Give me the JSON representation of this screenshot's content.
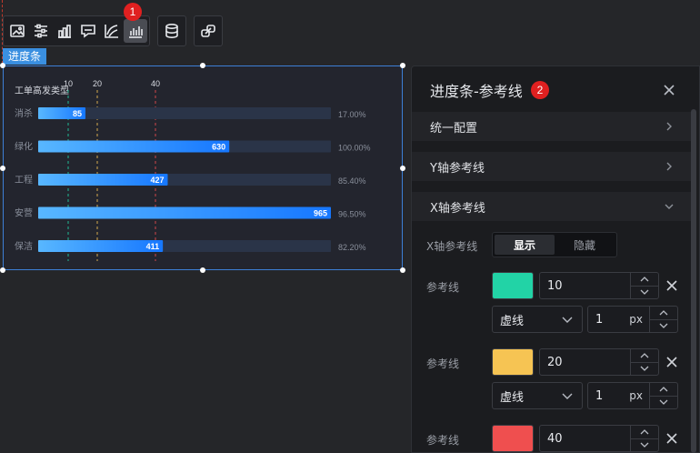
{
  "toolbar": {
    "groups": [
      [
        "image-icon",
        "sliders-icon",
        "bar-chart-icon",
        "comment-chart-icon",
        "curve-icon",
        "progress-chart-icon"
      ],
      [
        "database-icon"
      ],
      [
        "link-icon"
      ]
    ],
    "active": "progress-chart-icon",
    "badge": "1"
  },
  "component_label": "进度条",
  "chart_data": {
    "type": "bar",
    "orientation": "horizontal",
    "title": "工单高发类型",
    "categories": [
      "消杀",
      "绿化",
      "工程",
      "安营",
      "保洁"
    ],
    "values": [
      85,
      630,
      427,
      965,
      411
    ],
    "percent_labels": [
      "17.00%",
      "100.00%",
      "85.40%",
      "96.50%",
      "82.20%"
    ],
    "progress": [
      0.17,
      1.0,
      0.854,
      0.965,
      0.822
    ],
    "reference_lines": [
      {
        "value": 10,
        "label": "10",
        "color": "#22d3a6"
      },
      {
        "value": 20,
        "label": "20",
        "color": "#f6c453"
      },
      {
        "value": 40,
        "label": "40",
        "color": "#ef4f4f"
      }
    ],
    "bar_color_start": "#58b7ff",
    "bar_color_end": "#1677ff",
    "track_color": "#2a3448"
  },
  "panel": {
    "title": "进度条-参考线",
    "badge": "2",
    "sections": [
      "统一配置",
      "Y轴参考线",
      "X轴参考线"
    ],
    "x_axis": {
      "label": "X轴参考线",
      "show": "显示",
      "hide": "隐藏",
      "ref_label": "参考线",
      "lines": [
        {
          "color": "#22d3a6",
          "value": "10",
          "style": "虚线",
          "width": "1",
          "unit": "px"
        },
        {
          "color": "#f6c453",
          "value": "20",
          "style": "虚线",
          "width": "1",
          "unit": "px"
        },
        {
          "color": "#ef4f4f",
          "value": "40"
        }
      ]
    }
  }
}
